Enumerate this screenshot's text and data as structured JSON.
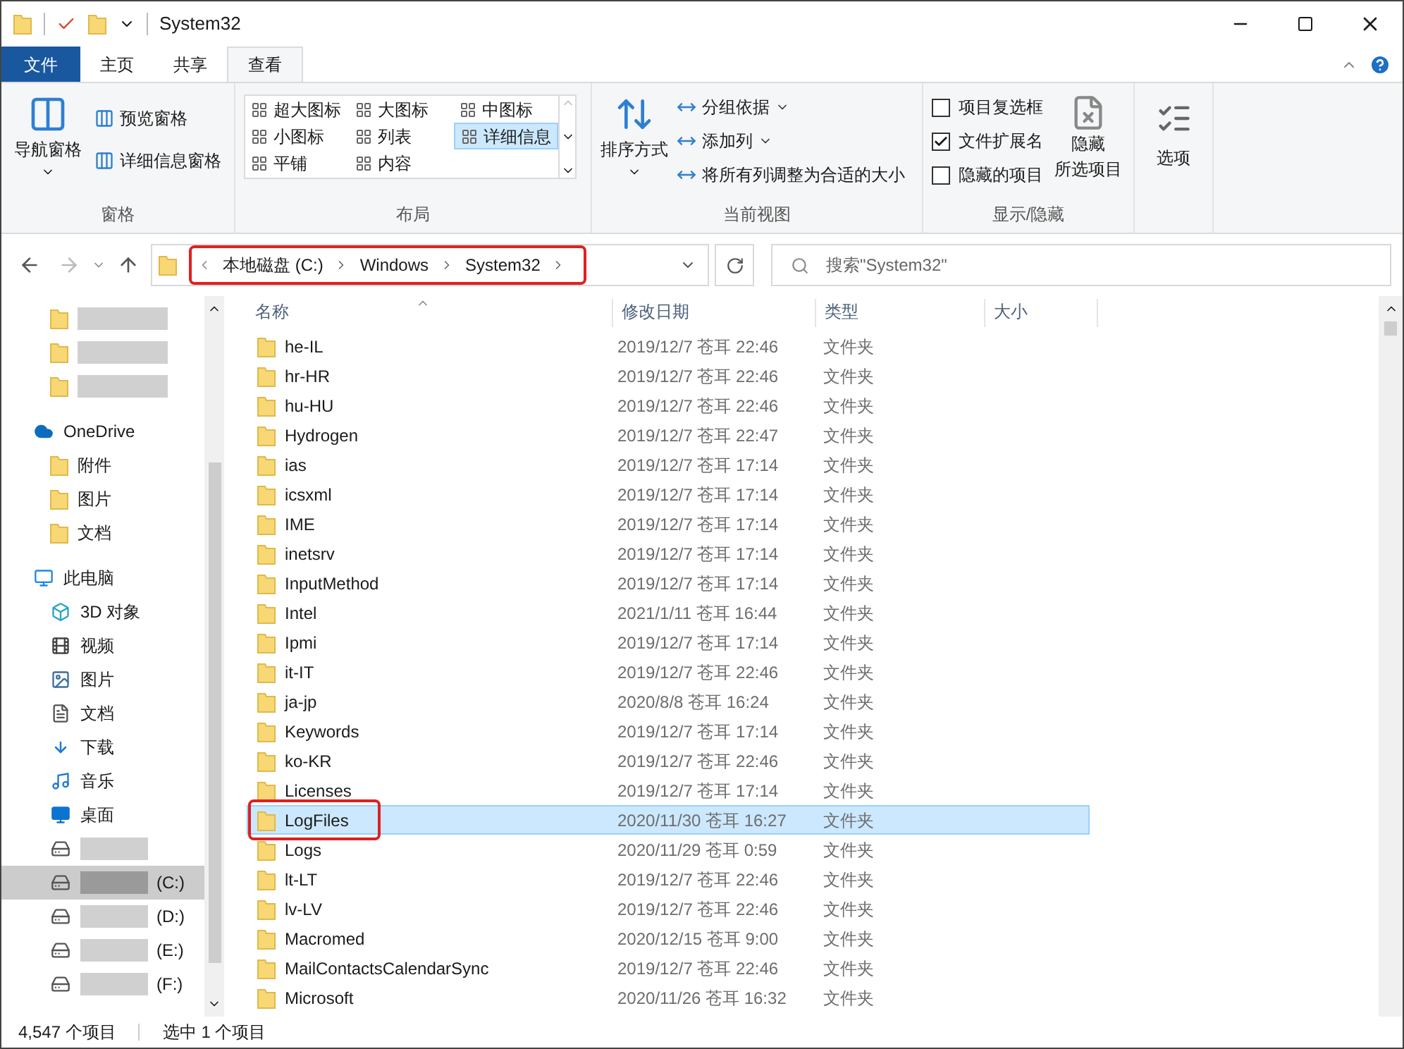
{
  "window": {
    "title": "System32"
  },
  "tabs": [
    {
      "label": "文件",
      "kind": "file",
      "selected": false
    },
    {
      "label": "主页",
      "kind": "tab",
      "selected": false
    },
    {
      "label": "共享",
      "kind": "tab",
      "selected": false
    },
    {
      "label": "查看",
      "kind": "tab",
      "selected": true
    }
  ],
  "ribbon": {
    "panes": {
      "big": "导航窗格",
      "small": [
        "预览窗格",
        "详细信息窗格"
      ],
      "group": "窗格"
    },
    "layout": {
      "items": [
        {
          "label": "超大图标",
          "selected": false
        },
        {
          "label": "大图标",
          "selected": false
        },
        {
          "label": "中图标",
          "selected": false
        },
        {
          "label": "小图标",
          "selected": false
        },
        {
          "label": "列表",
          "selected": false
        },
        {
          "label": "详细信息",
          "selected": true
        },
        {
          "label": "平铺",
          "selected": false
        },
        {
          "label": "内容",
          "selected": false
        }
      ],
      "group": "布局"
    },
    "current_view": {
      "big": "排序方式",
      "small": [
        {
          "label": "分组依据",
          "dropdown": true
        },
        {
          "label": "添加列",
          "dropdown": true
        },
        {
          "label": "将所有列调整为合适的大小",
          "dropdown": false
        }
      ],
      "group": "当前视图"
    },
    "show_hide": {
      "checks": [
        {
          "label": "项目复选框",
          "checked": false
        },
        {
          "label": "文件扩展名",
          "checked": true
        },
        {
          "label": "隐藏的项目",
          "checked": false
        }
      ],
      "big": [
        "隐藏",
        "所选项目"
      ],
      "group": "显示/隐藏"
    },
    "options": {
      "label": "选项"
    }
  },
  "address_bar": {
    "crumbs": [
      "本地磁盘 (C:)",
      "Windows",
      "System32"
    ],
    "highlighted": true
  },
  "search": {
    "placeholder": "搜索\"System32\""
  },
  "sidebar": {
    "items": [
      {
        "kind": "blurred",
        "selected": false
      },
      {
        "kind": "blurred",
        "selected": false
      },
      {
        "kind": "blurred",
        "selected": false
      },
      {
        "kind": "onedrive",
        "label": "OneDrive",
        "selected": false
      },
      {
        "kind": "folder",
        "label": "附件",
        "selected": false
      },
      {
        "kind": "folder",
        "label": "图片",
        "selected": false
      },
      {
        "kind": "folder",
        "label": "文档",
        "selected": false
      },
      {
        "kind": "pc",
        "label": "此电脑",
        "selected": false
      },
      {
        "kind": "cube",
        "label": "3D 对象",
        "selected": false
      },
      {
        "kind": "video",
        "label": "视频",
        "selected": false
      },
      {
        "kind": "picture",
        "label": "图片",
        "selected": false
      },
      {
        "kind": "document",
        "label": "文档",
        "selected": false
      },
      {
        "kind": "download",
        "label": "下载",
        "selected": false
      },
      {
        "kind": "music",
        "label": "音乐",
        "selected": false
      },
      {
        "kind": "desktop",
        "label": "桌面",
        "selected": false
      },
      {
        "kind": "drive",
        "selected": false
      },
      {
        "kind": "drive",
        "label": "(C:)",
        "selected": true
      },
      {
        "kind": "drive",
        "label": "(D:)",
        "selected": false
      },
      {
        "kind": "drive",
        "label": "(E:)",
        "selected": false
      },
      {
        "kind": "drive",
        "label": "(F:)",
        "selected": false
      }
    ]
  },
  "table": {
    "columns": [
      "名称",
      "修改日期",
      "类型",
      "大小"
    ],
    "rows": [
      {
        "name": "he-IL",
        "date": "2019/12/7 苍耳 22:46",
        "type": "文件夹",
        "selected": false,
        "highlighted": false
      },
      {
        "name": "hr-HR",
        "date": "2019/12/7 苍耳 22:46",
        "type": "文件夹",
        "selected": false,
        "highlighted": false
      },
      {
        "name": "hu-HU",
        "date": "2019/12/7 苍耳 22:46",
        "type": "文件夹",
        "selected": false,
        "highlighted": false
      },
      {
        "name": "Hydrogen",
        "date": "2019/12/7 苍耳 22:47",
        "type": "文件夹",
        "selected": false,
        "highlighted": false
      },
      {
        "name": "ias",
        "date": "2019/12/7 苍耳 17:14",
        "type": "文件夹",
        "selected": false,
        "highlighted": false
      },
      {
        "name": "icsxml",
        "date": "2019/12/7 苍耳 17:14",
        "type": "文件夹",
        "selected": false,
        "highlighted": false
      },
      {
        "name": "IME",
        "date": "2019/12/7 苍耳 17:14",
        "type": "文件夹",
        "selected": false,
        "highlighted": false
      },
      {
        "name": "inetsrv",
        "date": "2019/12/7 苍耳 17:14",
        "type": "文件夹",
        "selected": false,
        "highlighted": false
      },
      {
        "name": "InputMethod",
        "date": "2019/12/7 苍耳 17:14",
        "type": "文件夹",
        "selected": false,
        "highlighted": false
      },
      {
        "name": "Intel",
        "date": "2021/1/11 苍耳 16:44",
        "type": "文件夹",
        "selected": false,
        "highlighted": false
      },
      {
        "name": "Ipmi",
        "date": "2019/12/7 苍耳 17:14",
        "type": "文件夹",
        "selected": false,
        "highlighted": false
      },
      {
        "name": "it-IT",
        "date": "2019/12/7 苍耳 22:46",
        "type": "文件夹",
        "selected": false,
        "highlighted": false
      },
      {
        "name": "ja-jp",
        "date": "2020/8/8 苍耳 16:24",
        "type": "文件夹",
        "selected": false,
        "highlighted": false
      },
      {
        "name": "Keywords",
        "date": "2019/12/7 苍耳 17:14",
        "type": "文件夹",
        "selected": false,
        "highlighted": false
      },
      {
        "name": "ko-KR",
        "date": "2019/12/7 苍耳 22:46",
        "type": "文件夹",
        "selected": false,
        "highlighted": false
      },
      {
        "name": "Licenses",
        "date": "2019/12/7 苍耳 17:14",
        "type": "文件夹",
        "selected": false,
        "highlighted": false
      },
      {
        "name": "LogFiles",
        "date": "2020/11/30 苍耳 16:27",
        "type": "文件夹",
        "selected": true,
        "highlighted": true
      },
      {
        "name": "Logs",
        "date": "2020/11/29 苍耳 0:59",
        "type": "文件夹",
        "selected": false,
        "highlighted": false
      },
      {
        "name": "lt-LT",
        "date": "2019/12/7 苍耳 22:46",
        "type": "文件夹",
        "selected": false,
        "highlighted": false
      },
      {
        "name": "lv-LV",
        "date": "2019/12/7 苍耳 22:46",
        "type": "文件夹",
        "selected": false,
        "highlighted": false
      },
      {
        "name": "Macromed",
        "date": "2020/12/15 苍耳 9:00",
        "type": "文件夹",
        "selected": false,
        "highlighted": false
      },
      {
        "name": "MailContactsCalendarSync",
        "date": "2019/12/7 苍耳 22:46",
        "type": "文件夹",
        "selected": false,
        "highlighted": false
      },
      {
        "name": "Microsoft",
        "date": "2020/11/26 苍耳 16:32",
        "type": "文件夹",
        "selected": false,
        "highlighted": false
      }
    ]
  },
  "status_bar": {
    "count": "4,547 个项目",
    "selection": "选中 1 个项目"
  }
}
